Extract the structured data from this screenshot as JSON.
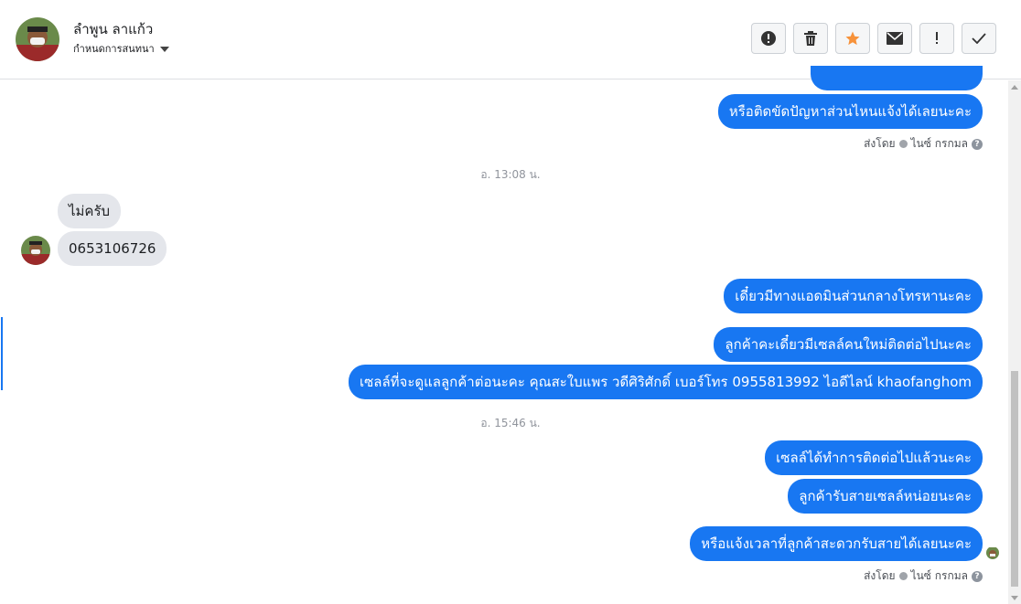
{
  "header": {
    "name": "ลำพูน ลาแก้ว",
    "assign_label": "กำหนดการสนทนา",
    "toolbar": [
      {
        "icon": "alert-circle-icon"
      },
      {
        "icon": "trash-icon"
      },
      {
        "icon": "star-icon"
      },
      {
        "icon": "envelope-icon"
      },
      {
        "icon": "exclamation-icon"
      },
      {
        "icon": "checkmark-icon"
      }
    ]
  },
  "colors": {
    "accent": "#1877f2",
    "star": "#f7923a",
    "incoming_bg": "#e4e6eb"
  },
  "messages": {
    "out1": "หรือติดขัดปัญหาส่วนไหนแจ้งได้เลยนะคะ",
    "sentby1": "ส่งโดย",
    "sentby1_name": "ไนซ์ กรกมล",
    "time1": "อ. 13:08 น.",
    "in1": "ไม่ครับ",
    "in2": "0653106726",
    "out2": "เดี๋ยวมีทางแอดมินส่วนกลางโทรหานะคะ",
    "out3": "ลูกค้าคะเดี๋ยวมีเซลล์คนใหม่ติดต่อไปนะคะ",
    "out4": "เซลล์ที่จะดูแลลูกค้าต่อนะคะ คุณสะใบแพร วดีศิริศักดิ์ เบอร์โทร 0955813992 ไอดีไลน์ khaofanghom",
    "time2": "อ. 15:46 น.",
    "out5": "เซลล์ได้ทำการติดต่อไปแล้วนะคะ",
    "out6": "ลูกค้ารับสายเซลล์หน่อยนะคะ",
    "out7": "หรือแจ้งเวลาที่ลูกค้าสะดวกรับสายได้เลยนะคะ",
    "sentby2": "ส่งโดย",
    "sentby2_name": "ไนซ์ กรกมล"
  }
}
